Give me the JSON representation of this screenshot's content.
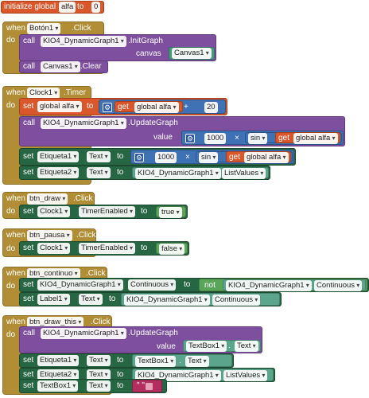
{
  "init": {
    "label": "initialize global",
    "name": "alfa",
    "to": "to",
    "value": "0"
  },
  "kw": {
    "when": "when",
    "do": "do",
    "call": "call",
    "set": "set",
    "to": "to",
    "get": "get"
  },
  "b1": {
    "comp": "Botón1",
    "event": ".Click",
    "call1_comp": "KIO4_DynamicGraph1",
    "call1_method": ".InitGraph",
    "param_canvas": "canvas",
    "canvas_val": "Canvas1",
    "call2_comp": "Canvas1",
    "call2_method": ".Clear"
  },
  "clock": {
    "comp": "Clock1",
    "event": ".Timer",
    "var": "global alfa",
    "get_var": "global alfa",
    "plus": "+",
    "num": "20",
    "call_comp": "KIO4_DynamicGraph1",
    "call_method": ".UpdateGraph",
    "param_value": "value",
    "num1000": "1000",
    "times": "×",
    "sin": "sin",
    "get_var2": "global alfa",
    "set1_comp": "Etiqueta1",
    "set1_prop": "Text",
    "num1000b": "1000",
    "times2": "×",
    "sin2": "sin",
    "get_var3": "global alfa",
    "set2_comp": "Etiqueta2",
    "set2_prop": "Text",
    "set2_val_comp": "KIO4_DynamicGraph1",
    "set2_val_prop": "ListValues"
  },
  "draw": {
    "comp": "btn_draw",
    "event": ".Click",
    "set_comp": "Clock1",
    "set_prop": "TimerEnabled",
    "value": "true"
  },
  "pausa": {
    "comp": "btn_pausa",
    "event": ".Click",
    "set_comp": "Clock1",
    "set_prop": "TimerEnabled",
    "value": "false"
  },
  "continuo": {
    "comp": "btn_continuo",
    "event": ".Click",
    "set1_comp": "KIO4_DynamicGraph1",
    "set1_prop": "Continuous",
    "not": "not",
    "not_comp": "KIO4_DynamicGraph1",
    "not_prop": "Continuous",
    "set2_comp": "Label1",
    "set2_prop": "Text",
    "set2_val_comp": "KIO4_DynamicGraph1",
    "set2_val_prop": "Continuous"
  },
  "drawthis": {
    "comp": "btn_draw_this",
    "event": ".Click",
    "call_comp": "KIO4_DynamicGraph1",
    "call_method": ".UpdateGraph",
    "param_value": "value",
    "val_comp": "TextBox1",
    "val_prop": "Text",
    "set1_comp": "Etiqueta1",
    "set1_prop": "Text",
    "set1_val_comp": "TextBox1",
    "set1_val_prop": "Text",
    "set2_comp": "Etiqueta2",
    "set2_prop": "Text",
    "set2_val_comp": "KIO4_DynamicGraph1",
    "set2_val_prop": "ListValues",
    "set3_comp": "TextBox1",
    "set3_prop": "Text",
    "empty_text": "\" \""
  },
  "colors": {
    "event": "#b18e35",
    "procedure": "#7d4f9e",
    "setter": "#266643",
    "variable": "#d9572b",
    "math": "#3f71b5",
    "logic": "#5ba55b",
    "text": "#b32d5e"
  }
}
